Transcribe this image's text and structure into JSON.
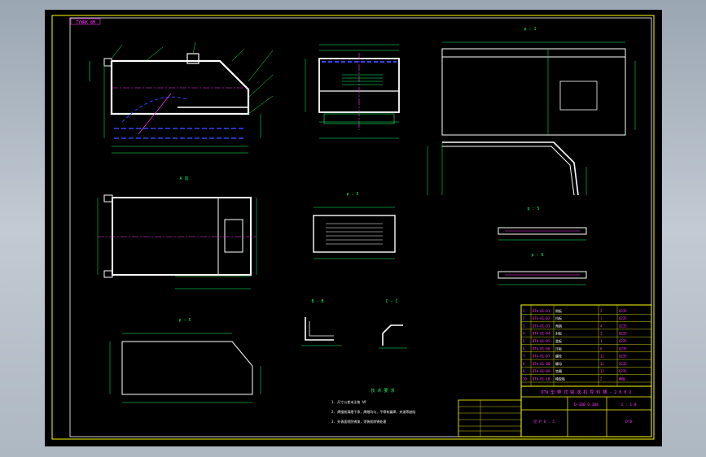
{
  "drawing": {
    "corner_tag": "TYWRK 8M",
    "section_bb": "B - B",
    "section_cc": "C - C",
    "view_a": "A 向",
    "view_p": "p : 5",
    "view_pi5": "p : 5",
    "view_pi6": "p : 6",
    "view_pi1": "p : 1",
    "view_top": "p : 5",
    "tech_title": "技 术 要 求",
    "notes": [
      "1. 尺寸公差未注按 h9",
      "2. 焊接前清理干净，焊缝均匀，不得有漏焊，夹渣等缺陷",
      "3. 外表面喷防锈漆，涂装前除锈处理"
    ],
    "title_block": {
      "main_title": "DTⅡ 型 带 式 输 送 机 导 料 槽 - 2 0 0 2",
      "drawing_no": "D-380 Q-308",
      "scale": "1 : 1 0",
      "weight": "见 P 8 . 5",
      "company": "DTⅡ"
    },
    "bom_rows": [
      [
        "1",
        "DTⅡ-01-01",
        "侧板",
        "2",
        "Q235"
      ],
      [
        "2",
        "DTⅡ-01-02",
        "挡板",
        "1",
        "Q235"
      ],
      [
        "3",
        "DTⅡ-01-03",
        "角钢",
        "4",
        "Q235"
      ],
      [
        "4",
        "DTⅡ-01-04",
        "封板",
        "2",
        "Q235"
      ],
      [
        "5",
        "DTⅡ-01-05",
        "盖板",
        "1",
        "Q235"
      ],
      [
        "6",
        "DTⅡ-01-06",
        "压板",
        "6",
        "Q235"
      ],
      [
        "7",
        "DTⅡ-01-07",
        "螺栓",
        "12",
        "Q235"
      ],
      [
        "8",
        "DTⅡ-01-08",
        "螺母",
        "12",
        "Q235"
      ],
      [
        "9",
        "DTⅡ-01-09",
        "垫圈",
        "12",
        "Q235"
      ],
      [
        "10",
        "DTⅡ-01-10",
        "橡胶板",
        "2",
        "橡胶"
      ]
    ]
  },
  "colors": {
    "outline": "#ffffff",
    "dimension": "#00ff66",
    "center": "#ff33ff",
    "hidden": "#3344ff",
    "frame": "#ffff00",
    "title": "#ff33ff"
  }
}
